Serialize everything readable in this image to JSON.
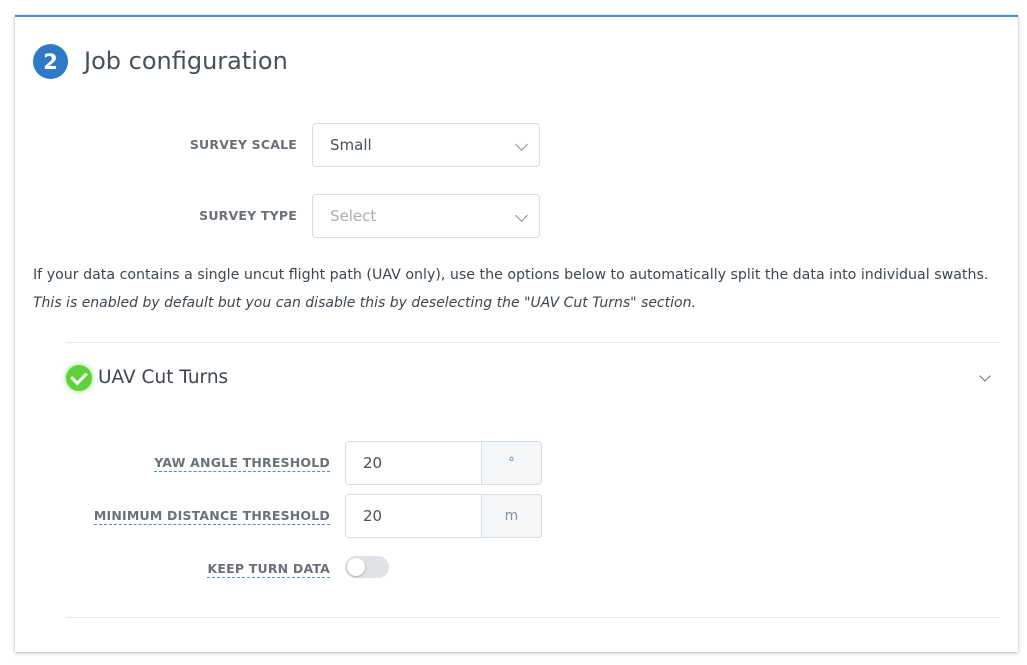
{
  "header": {
    "step_number": "2",
    "title": "Job configuration"
  },
  "survey_scale": {
    "label": "SURVEY SCALE",
    "value": "Small"
  },
  "survey_type": {
    "label": "SURVEY TYPE",
    "placeholder": "Select"
  },
  "info": {
    "text": "If your data contains a single uncut flight path (UAV only), use the options below to automatically split the data into individual swaths.",
    "note": "This is enabled by default but you can disable this by deselecting the \"UAV Cut Turns\" section."
  },
  "cut_turns": {
    "title": "UAV Cut Turns",
    "enabled": true,
    "yaw": {
      "label": "YAW ANGLE THRESHOLD",
      "value": "20",
      "unit": "°"
    },
    "min_distance": {
      "label": "MINIMUM DISTANCE THRESHOLD",
      "value": "20",
      "unit": "m"
    },
    "keep_turn_data": {
      "label": "KEEP TURN DATA",
      "on": false
    }
  },
  "colors": {
    "accent": "#2f7ac6",
    "success": "#5fd13a",
    "border": "#d8dce3"
  }
}
